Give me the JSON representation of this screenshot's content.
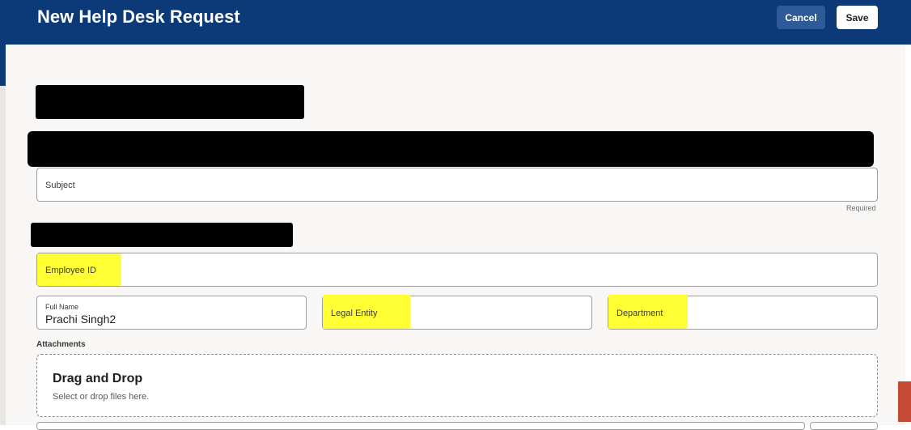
{
  "header": {
    "title": "New Help Desk Request",
    "cancel_label": "Cancel",
    "save_label": "Save"
  },
  "form": {
    "subject": {
      "label": "Subject",
      "value": "",
      "hint": "Required"
    },
    "employee_id": {
      "label": "Employee ID",
      "value": ""
    },
    "full_name": {
      "label": "Full Name",
      "value": "Prachi Singh2"
    },
    "legal_entity": {
      "label": "Legal Entity",
      "value": ""
    },
    "department": {
      "label": "Department",
      "value": ""
    }
  },
  "attachments": {
    "label": "Attachments",
    "drop_title": "Drag and Drop",
    "drop_hint": "Select or drop files here."
  },
  "colors": {
    "header_bg": "#0c3a78",
    "highlight": "#ffff33",
    "accent_tab": "#c44a36"
  }
}
